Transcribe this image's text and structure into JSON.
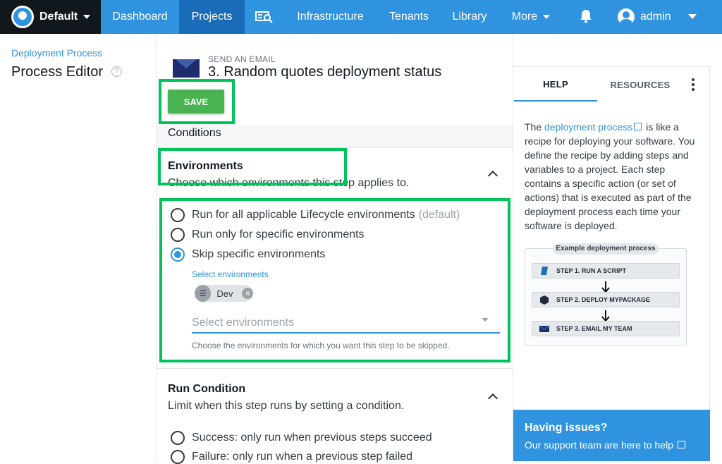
{
  "header": {
    "space_name": "Default",
    "nav": [
      "Dashboard",
      "Projects",
      "Infrastructure",
      "Tenants",
      "Library",
      "More"
    ],
    "active_nav": "Projects",
    "user_name": "admin",
    "accent_color": "#2f93e0"
  },
  "left": {
    "breadcrumb": "Deployment Process",
    "title": "Process Editor"
  },
  "step": {
    "caption": "SEND AN EMAIL",
    "title": "3.  Random quotes deployment status",
    "save_label": "SAVE"
  },
  "conditions": {
    "heading": "Conditions",
    "environments": {
      "title": "Environments",
      "description": "Choose which environments this step applies to.",
      "options": [
        {
          "label": "Run for all applicable Lifecycle environments",
          "suffix": "(default)",
          "checked": false
        },
        {
          "label": "Run only for specific environments",
          "suffix": "",
          "checked": false
        },
        {
          "label": "Skip specific environments",
          "suffix": "",
          "checked": true
        }
      ],
      "select_label": "Select environments",
      "chip": "Dev",
      "input_placeholder": "Select environments",
      "input_hint": "Choose the environments for which you want this step to be skipped."
    },
    "run_condition": {
      "title": "Run Condition",
      "description": "Limit when this step runs by setting a condition.",
      "options": [
        {
          "label": "Success: only run when previous steps succeed",
          "checked": false
        },
        {
          "label": "Failure: only run when a previous step failed",
          "checked": false
        }
      ]
    }
  },
  "sidebar": {
    "tabs": [
      "HELP",
      "RESOURCES"
    ],
    "active_tab": "HELP",
    "help_prefix": "The ",
    "help_link": "deployment process",
    "help_body": " is like a recipe for deploying your software. You define the recipe by adding steps and variables to a project. Each step contains a specific action (or set of actions) that is executed as part of the deployment process each time your software is deployed.",
    "diagram": {
      "title": "Example deployment process",
      "steps": [
        "STEP 1. RUN A SCRIPT",
        "STEP 2. DEPLOY MYPACKAGE",
        "STEP 3. EMAIL MY TEAM"
      ]
    },
    "support_title": "Having issues?",
    "support_text": "Our support team are here to help"
  }
}
